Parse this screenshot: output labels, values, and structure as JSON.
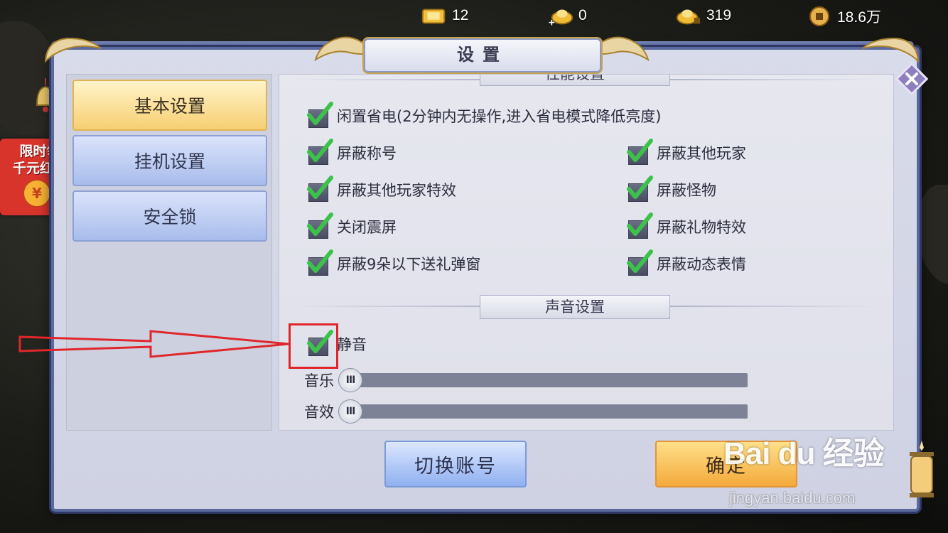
{
  "currency_bar": [
    {
      "icon": "vip-gold-ingot-icon",
      "value": "12"
    },
    {
      "icon": "bound-gold-ingot-icon",
      "value": "0"
    },
    {
      "icon": "locked-gold-ingot-icon",
      "value": "319"
    },
    {
      "icon": "copper-coin-icon",
      "value": "18.6万"
    }
  ],
  "promo": {
    "line1": "限时领",
    "line2": "千元红包",
    "coin_symbol": "¥"
  },
  "dialog": {
    "title": "设置",
    "close_icon": "close-icon"
  },
  "tabs": [
    {
      "label": "基本设置",
      "active": true
    },
    {
      "label": "挂机设置",
      "active": false
    },
    {
      "label": "安全锁",
      "active": false
    }
  ],
  "performance": {
    "heading": "性能设置",
    "options": [
      {
        "label": "闲置省电(2分钟内无操作,进入省电模式降低亮度)",
        "checked": true
      },
      {
        "label": "屏蔽称号",
        "checked": true
      },
      {
        "label": "屏蔽其他玩家",
        "checked": true
      },
      {
        "label": "屏蔽其他玩家特效",
        "checked": true
      },
      {
        "label": "屏蔽怪物",
        "checked": true
      },
      {
        "label": "关闭震屏",
        "checked": true
      },
      {
        "label": "屏蔽礼物特效",
        "checked": true
      },
      {
        "label": "屏蔽9朵以下送礼弹窗",
        "checked": true
      },
      {
        "label": "屏蔽动态表情",
        "checked": true
      }
    ]
  },
  "sound": {
    "heading": "声音设置",
    "mute": {
      "label": "静音",
      "checked": true
    },
    "music": {
      "label": "音乐",
      "level": 0
    },
    "effects": {
      "label": "音效",
      "level": 0
    },
    "thumb_glyph": "III"
  },
  "buttons": {
    "switch_account": "切换账号",
    "confirm": "确定"
  },
  "watermark": {
    "brand": "Bai du 经验",
    "url": "jingyan.baidu.com"
  },
  "colors": {
    "highlight_red": "#e0262a",
    "check_green": "#3cc24a",
    "active_tab": "#f7cf72"
  }
}
